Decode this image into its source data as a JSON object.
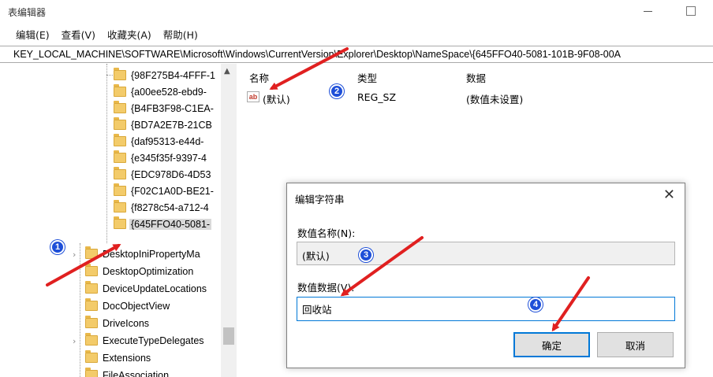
{
  "window": {
    "title": "表编辑器"
  },
  "menu": [
    "编辑(E)",
    "查看(V)",
    "收藏夹(A)",
    "帮助(H)"
  ],
  "address": "KEY_LOCAL_MACHINE\\SOFTWARE\\Microsoft\\Windows\\CurrentVersion\\Explorer\\Desktop\\NameSpace\\{645FFO40-5081-101B-9F08-00A",
  "tree": {
    "guid_items": [
      "{98F275B4-4FFF-1",
      "{a00ee528-ebd9-",
      "{B4FB3F98-C1EA-",
      "{BD7A2E7B-21CB",
      "{daf95313-e44d-",
      "{e345f35f-9397-4",
      "{EDC978D6-4D53",
      "{F02C1A0D-BE21-",
      "{f8278c54-a712-4",
      "{645FFO40-5081-"
    ],
    "items": [
      "DesktopIniPropertyMa",
      "DesktopOptimization",
      "DeviceUpdateLocations",
      "DocObjectView",
      "DriveIcons",
      "ExecuteTypeDelegates",
      "Extensions",
      "FileAssociation"
    ]
  },
  "list": {
    "headers": {
      "name": "名称",
      "type": "类型",
      "data": "数据"
    },
    "row": {
      "name": "(默认)",
      "type": "REG_SZ",
      "data": "(数值未设置)",
      "icon": "ab-icon"
    }
  },
  "dialog": {
    "title": "编辑字符串",
    "name_label": "数值名称(N):",
    "name_value": "(默认)",
    "data_label": "数值数据(V):",
    "data_value": "回收站",
    "ok": "确定",
    "cancel": "取消"
  },
  "badges": [
    "1",
    "2",
    "3",
    "4"
  ],
  "colors": {
    "arrow": "#e02020",
    "badge": "#1e4fd8",
    "focus": "#0078d7"
  }
}
